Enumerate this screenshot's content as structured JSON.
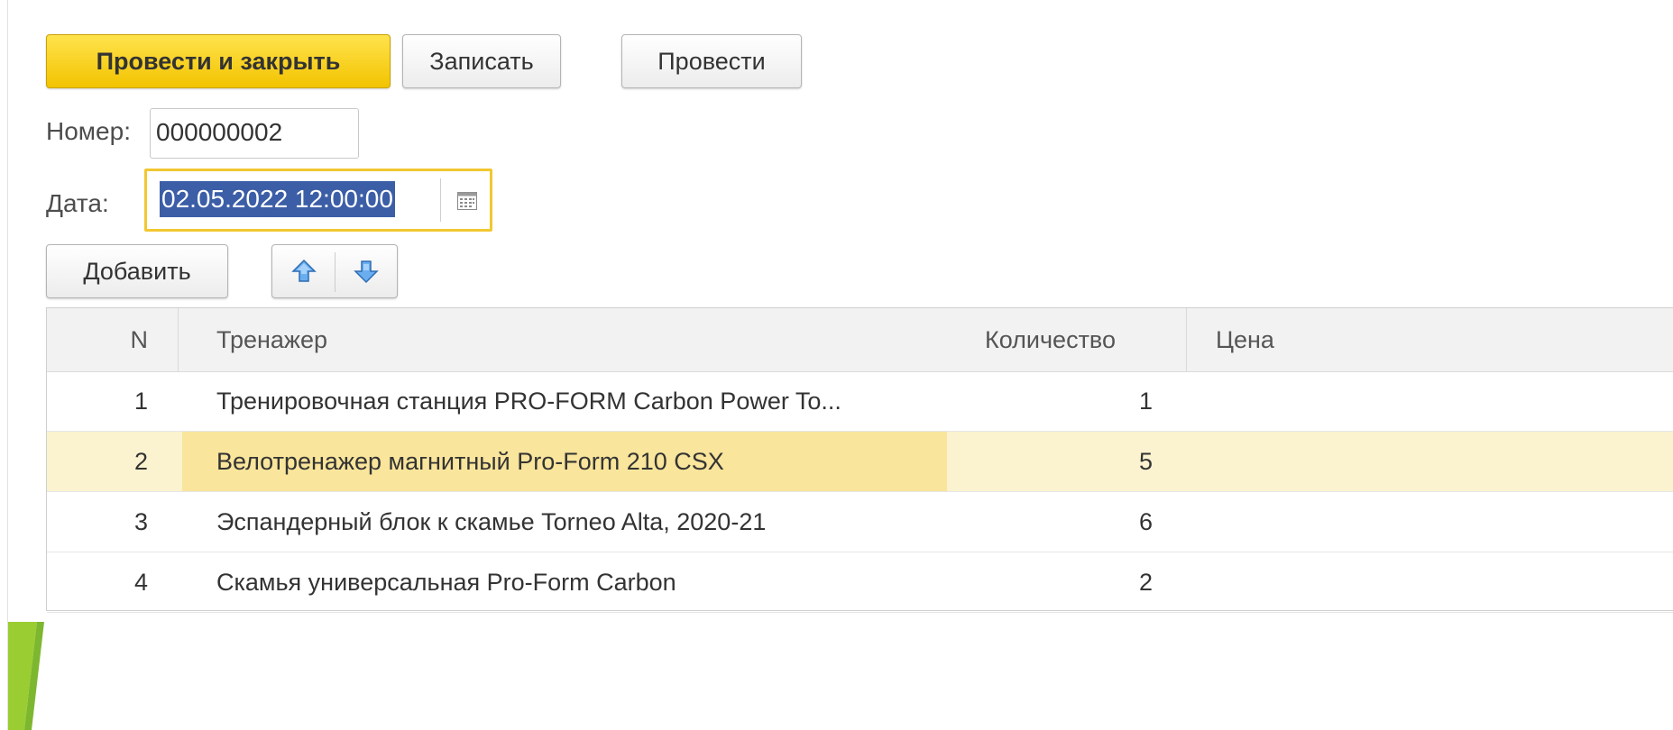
{
  "toolbar": {
    "post_close_label": "Провести и закрыть",
    "save_label": "Записать",
    "post_label": "Провести"
  },
  "fields": {
    "number_label": "Номер:",
    "number_value": "000000002",
    "date_label": "Дата:",
    "date_value": "02.05.2022 12:00:00"
  },
  "table_toolbar": {
    "add_label": "Добавить",
    "move_up_icon": "arrow-up-icon",
    "move_down_icon": "arrow-down-icon"
  },
  "table": {
    "columns": [
      "N",
      "Тренажер",
      "Количество",
      "Цена"
    ],
    "rows": [
      {
        "n": "1",
        "name": "Тренировочная станция PRO-FORM Carbon Power To...",
        "qty": "1",
        "price": ""
      },
      {
        "n": "2",
        "name": "Велотренажер магнитный Pro-Form 210 CSX",
        "qty": "5",
        "price": ""
      },
      {
        "n": "3",
        "name": "Эспандерный блок к скамье Torneo Alta, 2020-21",
        "qty": "6",
        "price": ""
      },
      {
        "n": "4",
        "name": "Скамья универсальная Pro-Form Carbon",
        "qty": "2",
        "price": ""
      }
    ],
    "selected_row": 2
  },
  "colors": {
    "primary_button": "#f2c300",
    "focus_border": "#f2c731",
    "selected_row": "#fbf3cf",
    "selected_cell": "#f9e59b",
    "selection": "#3b5ea7",
    "arrow_icon": "#4a90d9"
  }
}
